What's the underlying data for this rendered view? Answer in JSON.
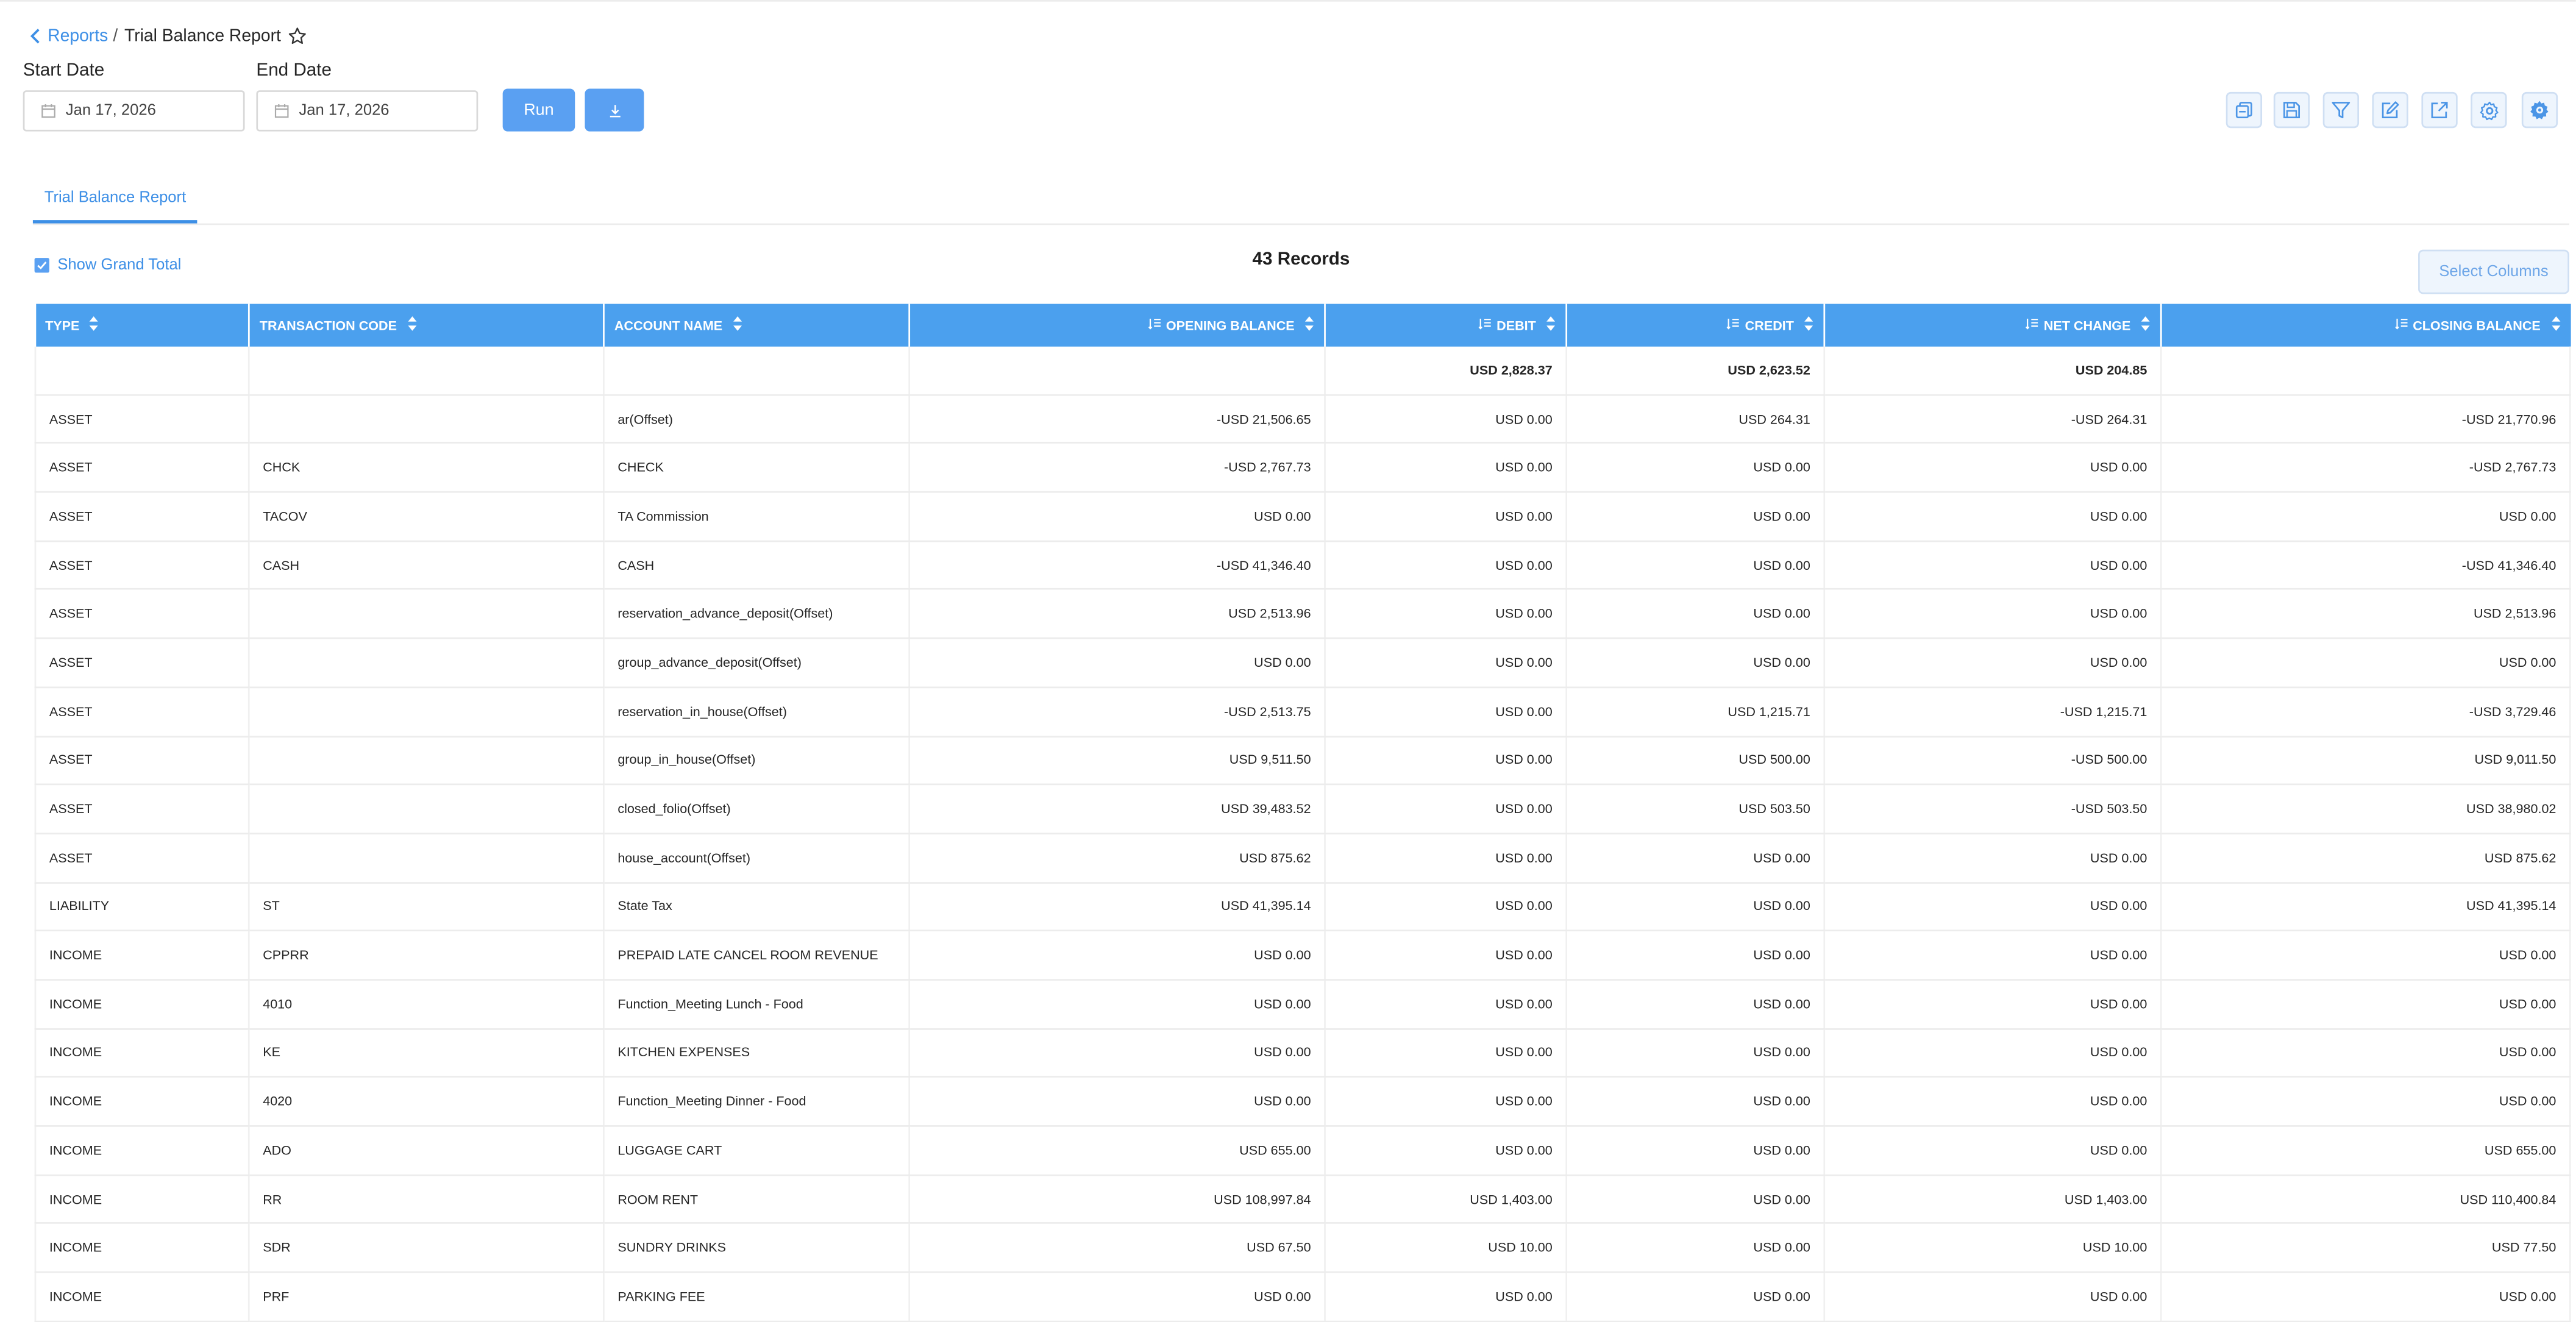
{
  "breadcrumb": {
    "parent": "Reports",
    "separator": "/",
    "current": "Trial Balance Report"
  },
  "filters": {
    "start_label": "Start Date",
    "end_label": "End Date",
    "start_value": "Jan 17, 2026",
    "end_value": "Jan 17, 2026"
  },
  "actions": {
    "run_label": "Run",
    "download_icon": "download-icon"
  },
  "toolbar": {
    "icons": [
      "report-copy-icon",
      "save-icon",
      "filter-icon",
      "edit-icon",
      "external-link-icon",
      "settings-icon",
      "advanced-settings-icon"
    ]
  },
  "tabs": {
    "active": "Trial Balance Report"
  },
  "summary": {
    "show_grand_total": "Show Grand Total",
    "records": "43 Records",
    "select_columns": "Select Columns"
  },
  "colors": {
    "accent": "#3d8fe6",
    "header_bg": "#4ba0ee",
    "button_bg": "#5aa0f2"
  },
  "table": {
    "columns": [
      "TYPE",
      "TRANSACTION CODE",
      "ACCOUNT NAME",
      "OPENING BALANCE",
      "DEBIT",
      "CREDIT",
      "NET CHANGE",
      "CLOSING BALANCE"
    ],
    "totals": {
      "debit": "USD 2,828.37",
      "credit": "USD 2,623.52",
      "net_change": "USD 204.85"
    },
    "rows": [
      [
        "ASSET",
        "",
        "ar(Offset)",
        "-USD 21,506.65",
        "USD 0.00",
        "USD 264.31",
        "-USD 264.31",
        "-USD 21,770.96"
      ],
      [
        "ASSET",
        "CHCK",
        "CHECK",
        "-USD 2,767.73",
        "USD 0.00",
        "USD 0.00",
        "USD 0.00",
        "-USD 2,767.73"
      ],
      [
        "ASSET",
        "TACOV",
        "TA Commission",
        "USD 0.00",
        "USD 0.00",
        "USD 0.00",
        "USD 0.00",
        "USD 0.00"
      ],
      [
        "ASSET",
        "CASH",
        "CASH",
        "-USD 41,346.40",
        "USD 0.00",
        "USD 0.00",
        "USD 0.00",
        "-USD 41,346.40"
      ],
      [
        "ASSET",
        "",
        "reservation_advance_deposit(Offset)",
        "USD 2,513.96",
        "USD 0.00",
        "USD 0.00",
        "USD 0.00",
        "USD 2,513.96"
      ],
      [
        "ASSET",
        "",
        "group_advance_deposit(Offset)",
        "USD 0.00",
        "USD 0.00",
        "USD 0.00",
        "USD 0.00",
        "USD 0.00"
      ],
      [
        "ASSET",
        "",
        "reservation_in_house(Offset)",
        "-USD 2,513.75",
        "USD 0.00",
        "USD 1,215.71",
        "-USD 1,215.71",
        "-USD 3,729.46"
      ],
      [
        "ASSET",
        "",
        "group_in_house(Offset)",
        "USD 9,511.50",
        "USD 0.00",
        "USD 500.00",
        "-USD 500.00",
        "USD 9,011.50"
      ],
      [
        "ASSET",
        "",
        "closed_folio(Offset)",
        "USD 39,483.52",
        "USD 0.00",
        "USD 503.50",
        "-USD 503.50",
        "USD 38,980.02"
      ],
      [
        "ASSET",
        "",
        "house_account(Offset)",
        "USD 875.62",
        "USD 0.00",
        "USD 0.00",
        "USD 0.00",
        "USD 875.62"
      ],
      [
        "LIABILITY",
        "ST",
        "State Tax",
        "USD 41,395.14",
        "USD 0.00",
        "USD 0.00",
        "USD 0.00",
        "USD 41,395.14"
      ],
      [
        "INCOME",
        "CPPRR",
        "PREPAID LATE CANCEL ROOM REVENUE",
        "USD 0.00",
        "USD 0.00",
        "USD 0.00",
        "USD 0.00",
        "USD 0.00"
      ],
      [
        "INCOME",
        "4010",
        "Function_Meeting Lunch - Food",
        "USD 0.00",
        "USD 0.00",
        "USD 0.00",
        "USD 0.00",
        "USD 0.00"
      ],
      [
        "INCOME",
        "KE",
        "KITCHEN EXPENSES",
        "USD 0.00",
        "USD 0.00",
        "USD 0.00",
        "USD 0.00",
        "USD 0.00"
      ],
      [
        "INCOME",
        "4020",
        "Function_Meeting Dinner - Food",
        "USD 0.00",
        "USD 0.00",
        "USD 0.00",
        "USD 0.00",
        "USD 0.00"
      ],
      [
        "INCOME",
        "ADO",
        "LUGGAGE CART",
        "USD 655.00",
        "USD 0.00",
        "USD 0.00",
        "USD 0.00",
        "USD 655.00"
      ],
      [
        "INCOME",
        "RR",
        "ROOM RENT",
        "USD 108,997.84",
        "USD 1,403.00",
        "USD 0.00",
        "USD 1,403.00",
        "USD 110,400.84"
      ],
      [
        "INCOME",
        "SDR",
        "SUNDRY DRINKS",
        "USD 67.50",
        "USD 10.00",
        "USD 0.00",
        "USD 10.00",
        "USD 77.50"
      ],
      [
        "INCOME",
        "PRF",
        "PARKING FEE",
        "USD 0.00",
        "USD 0.00",
        "USD 0.00",
        "USD 0.00",
        "USD 0.00"
      ]
    ]
  }
}
